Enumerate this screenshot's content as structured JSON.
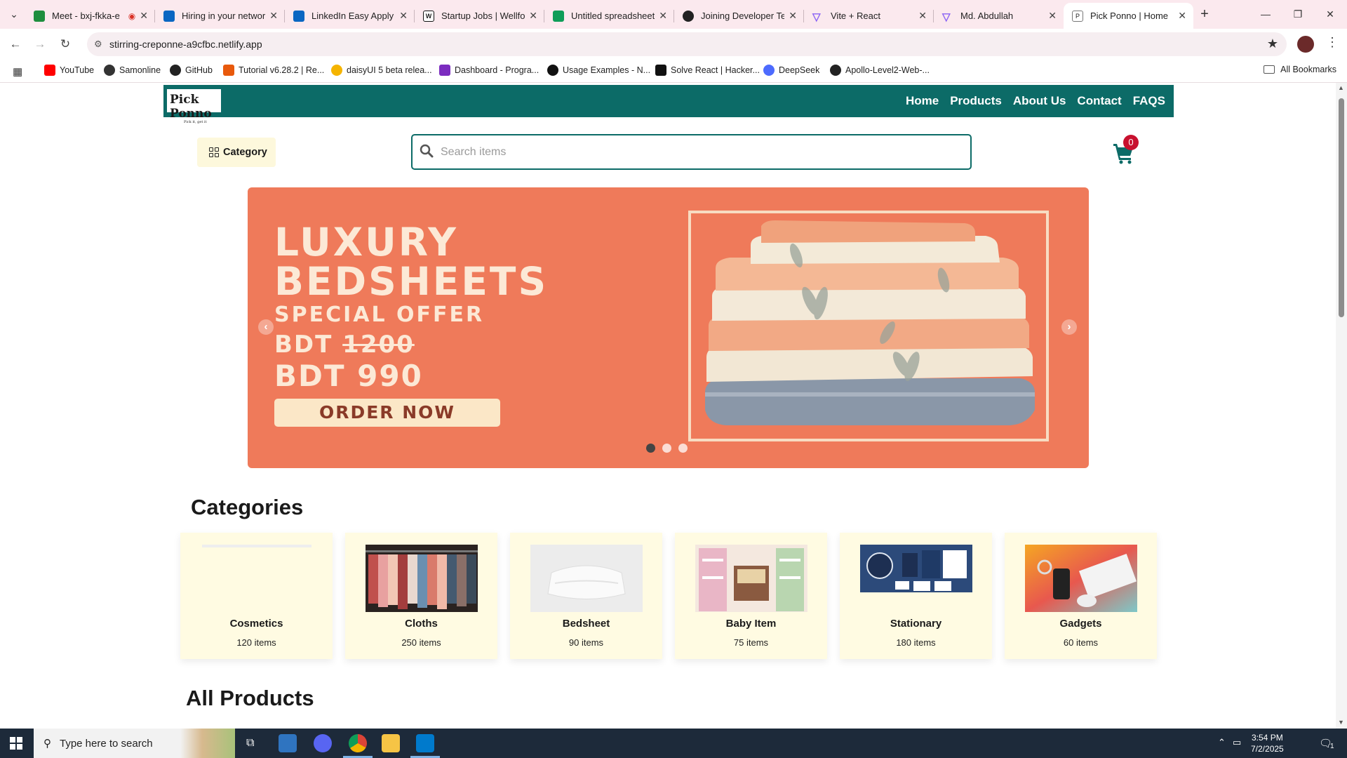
{
  "browser": {
    "tabs": [
      {
        "title": "Meet - bxj-fkka-e",
        "favicon_color": "#1e8e3e",
        "recording": true
      },
      {
        "title": "Hiring in your networ",
        "favicon_color": "#0a66c2"
      },
      {
        "title": "LinkedIn Easy Apply jo",
        "favicon_color": "#0a66c2"
      },
      {
        "title": "Startup Jobs | Wellfou",
        "favicon_color": "#111111"
      },
      {
        "title": "Untitled spreadsheet",
        "favicon_color": "#0f9d58"
      },
      {
        "title": "Joining Developer Te",
        "favicon_color": "#222222"
      },
      {
        "title": "Vite + React",
        "favicon_color": "#8a63f5"
      },
      {
        "title": "Md. Abdullah",
        "favicon_color": "#8a63f5"
      },
      {
        "title": "Pick Ponno | Home",
        "favicon_color": "#6a6a6a",
        "active": true
      }
    ],
    "url": "stirring-creponne-a9cfbc.netlify.app",
    "bookmarks": [
      {
        "label": "YouTube",
        "icon_color": "#ff0000"
      },
      {
        "label": "Samonline",
        "icon_color": "#333333"
      },
      {
        "label": "GitHub",
        "icon_color": "#222222"
      },
      {
        "label": "Tutorial v6.28.2 | Re...",
        "icon_color": "#e8590c"
      },
      {
        "label": "daisyUI 5 beta relea...",
        "icon_color": "#f5b400"
      },
      {
        "label": "Dashboard - Progra...",
        "icon_color": "#7b2cbf"
      },
      {
        "label": "Usage Examples - N...",
        "icon_color": "#111111"
      },
      {
        "label": "Solve React | Hacker...",
        "icon_color": "#111111"
      },
      {
        "label": "DeepSeek",
        "icon_color": "#4d6bfe"
      },
      {
        "label": "Apollo-Level2-Web-...",
        "icon_color": "#222222"
      }
    ],
    "all_bookmarks_label": "All Bookmarks"
  },
  "site": {
    "logo_text": "Pick Ponno",
    "logo_tagline": "Pick it, get it",
    "nav": [
      "Home",
      "Products",
      "About Us",
      "Contact",
      "FAQS"
    ],
    "category_button": "Category",
    "search_placeholder": "Search items",
    "cart_count": "0",
    "brand_color": "#0c6b67",
    "banner": {
      "line1": "LUXURY",
      "line2": "BEDSHEETS",
      "line3": "SPECIAL OFFER",
      "old_price_prefix": "BDT ",
      "old_price": "1200",
      "new_price": "BDT 990",
      "cta": "ORDER NOW",
      "slides": 3,
      "active_slide": 1
    },
    "categories_title": "Categories",
    "categories": [
      {
        "name": "Cosmetics",
        "count": "120 items"
      },
      {
        "name": "Cloths",
        "count": "250 items"
      },
      {
        "name": "Bedsheet",
        "count": "90 items"
      },
      {
        "name": "Baby Item",
        "count": "75 items"
      },
      {
        "name": "Stationary",
        "count": "180 items"
      },
      {
        "name": "Gadgets",
        "count": "60 items"
      }
    ],
    "all_products_title": "All Products"
  },
  "taskbar": {
    "search_placeholder": "Type here to search",
    "time": "3:54 PM",
    "date": "7/2/2025",
    "notification_count": "1"
  }
}
